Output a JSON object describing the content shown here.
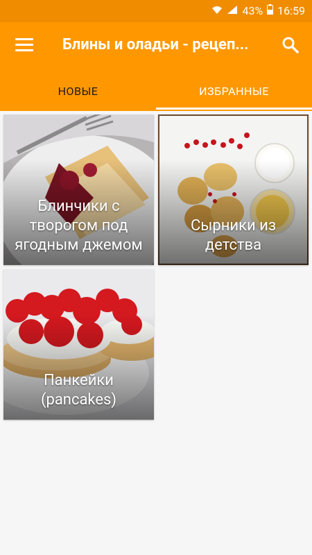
{
  "status": {
    "battery": "43%",
    "time": "16:59"
  },
  "appbar": {
    "title": "Блины и оладьи - рецеп..."
  },
  "tabs": [
    {
      "label": "НОВЫЕ",
      "active": false
    },
    {
      "label": "ИЗБРАННЫЕ",
      "active": true
    }
  ],
  "recipes": [
    {
      "caption": "Блинчики с творогом под ягодным джемом"
    },
    {
      "caption": "Сырники из детства"
    },
    {
      "caption": "Панкейки (pancakes)"
    }
  ],
  "colors": {
    "primary": "#ff9800",
    "status_bar": "#f08c00",
    "background": "#f6f6f6"
  }
}
